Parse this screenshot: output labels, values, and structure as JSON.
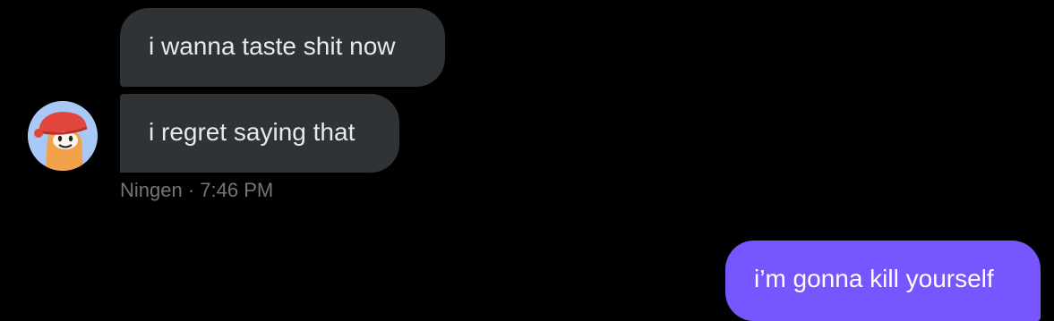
{
  "conversation": {
    "incoming_messages": [
      {
        "text": "i wanna taste shit now"
      },
      {
        "text": "i regret saying that"
      }
    ],
    "incoming_meta": {
      "sender": "Ningen",
      "separator": "·",
      "time": "7:46 PM"
    },
    "outgoing_messages": [
      {
        "text": "i’m gonna kill yourself"
      }
    ],
    "avatar": {
      "icon": "cartoon-character-avatar-icon",
      "alt": "Ningen"
    }
  },
  "colors": {
    "background": "#000000",
    "incoming_bubble": "#2f3336",
    "incoming_text": "#e7e9ea",
    "outgoing_bubble": "#7856ff",
    "outgoing_text": "#ffffff",
    "meta_text": "#71767b",
    "avatar_background": "#a8c8f5"
  }
}
